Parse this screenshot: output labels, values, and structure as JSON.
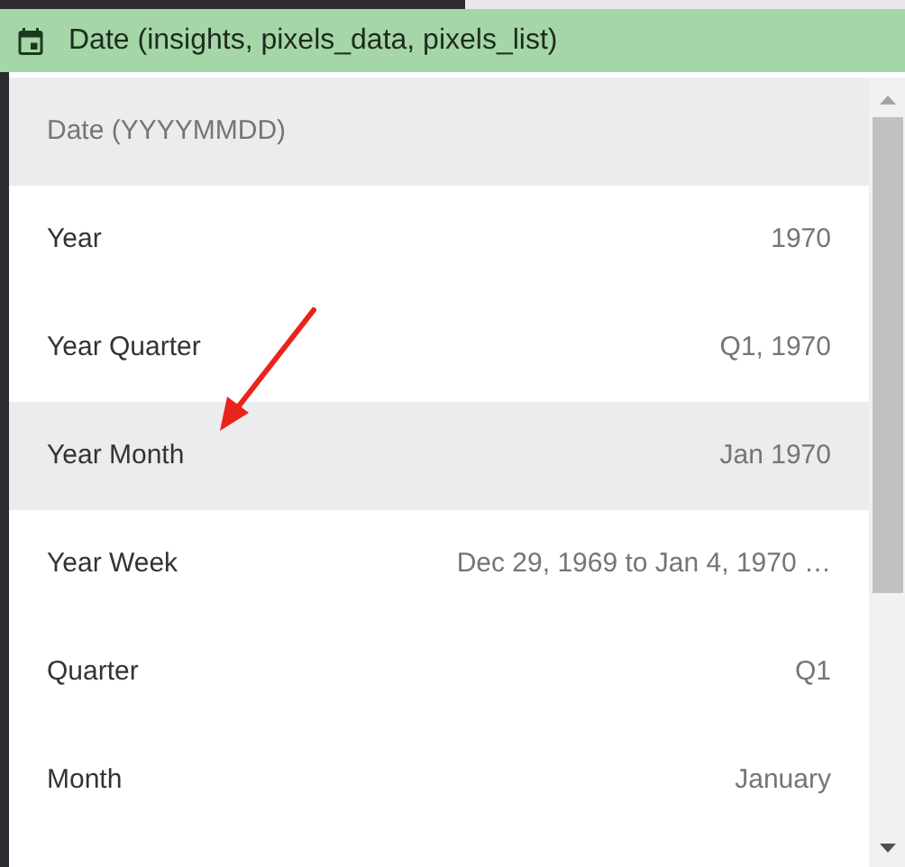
{
  "field": {
    "label": "Date (insights, pixels_data, pixels_list)"
  },
  "options": [
    {
      "kind": "header",
      "label": "Date (YYYYMMDD)"
    },
    {
      "kind": "option",
      "label": "Year",
      "example": "1970",
      "selected": false
    },
    {
      "kind": "option",
      "label": "Year Quarter",
      "example": "Q1, 1970",
      "selected": false
    },
    {
      "kind": "option",
      "label": "Year Month",
      "example": "Jan 1970",
      "selected": true
    },
    {
      "kind": "option",
      "label": "Year Week",
      "example": "Dec 29, 1969 to Jan 4, 1970 …",
      "selected": false
    },
    {
      "kind": "option",
      "label": "Quarter",
      "example": "Q1",
      "selected": false
    },
    {
      "kind": "option",
      "label": "Month",
      "example": "January",
      "selected": false
    }
  ]
}
